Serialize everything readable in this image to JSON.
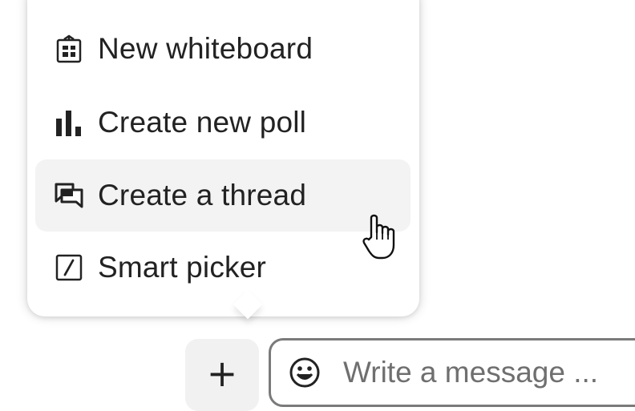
{
  "menu": {
    "items": [
      {
        "label": "New whiteboard",
        "icon": "whiteboard-icon"
      },
      {
        "label": "Create new poll",
        "icon": "poll-icon"
      },
      {
        "label": "Create a thread",
        "icon": "thread-icon",
        "hovered": true
      },
      {
        "label": "Smart picker",
        "icon": "smart-picker-icon"
      }
    ]
  },
  "composer": {
    "add_button_icon": "plus-icon",
    "emoji_icon": "emoji-icon",
    "placeholder": "Write a message ..."
  },
  "colors": {
    "text": "#222222",
    "placeholder": "#6f6f6f",
    "hover_bg": "#f3f3f3",
    "button_bg": "#f1f1f1",
    "input_border": "#7a7a7a"
  }
}
